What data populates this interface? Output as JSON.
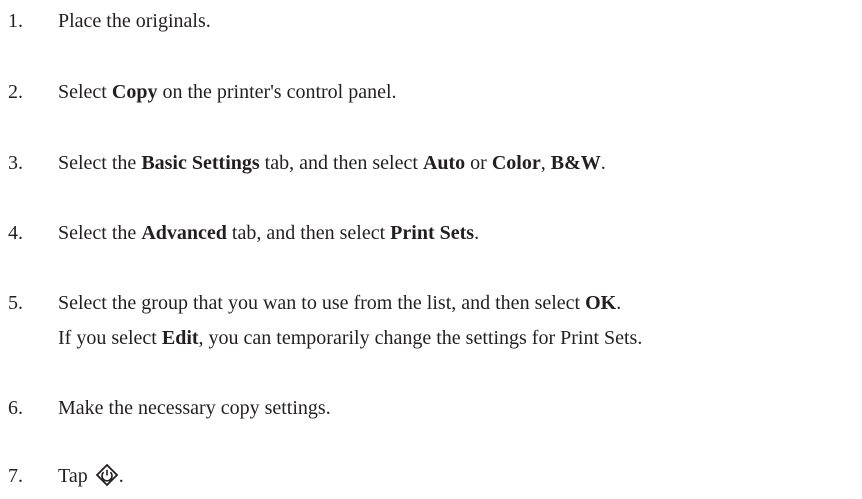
{
  "steps": [
    {
      "number": "1.",
      "parts": [
        "Place the originals."
      ]
    },
    {
      "number": "2.",
      "parts": [
        "Select ",
        "Copy",
        " on the printer's control panel."
      ]
    },
    {
      "number": "3.",
      "parts": [
        "Select the ",
        "Basic Settings",
        " tab, and then select ",
        "Auto",
        " or ",
        "Color",
        ", ",
        "B&W",
        "."
      ]
    },
    {
      "number": "4.",
      "parts": [
        "Select the ",
        "Advanced",
        " tab, and then select ",
        "Print Sets",
        "."
      ]
    },
    {
      "number": "5.",
      "parts": [
        "Select the group that you wan to use from the list, and then select ",
        "OK",
        "."
      ],
      "note": [
        "If you select ",
        "Edit",
        ", you can temporarily change the settings for Print Sets."
      ]
    },
    {
      "number": "6.",
      "parts": [
        "Make the necessary copy settings."
      ]
    },
    {
      "number": "7.",
      "parts": [
        "Tap ",
        "."
      ],
      "icon": "start-diamond-icon"
    }
  ]
}
